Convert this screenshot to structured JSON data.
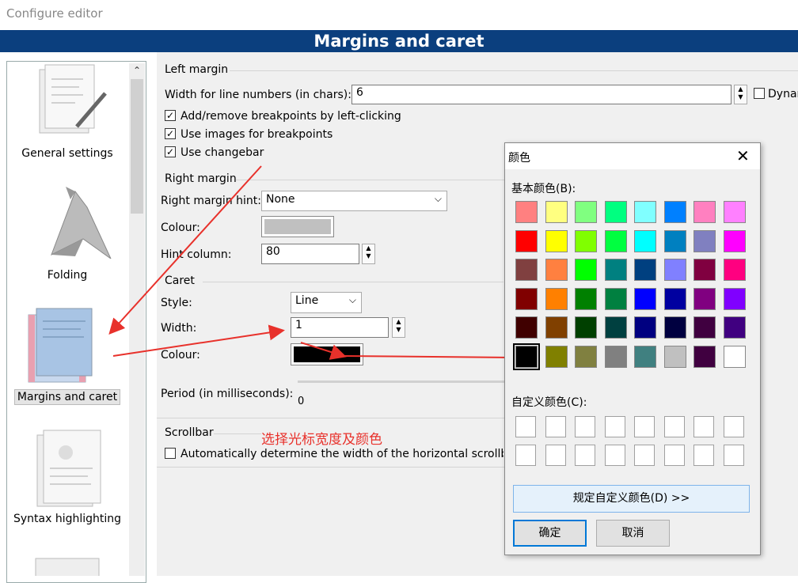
{
  "window": {
    "title": "Configure editor"
  },
  "banner": {
    "title": "Margins and caret"
  },
  "sidebar": {
    "items": [
      {
        "label": "General settings",
        "icon": "pencil-document-icon"
      },
      {
        "label": "Folding",
        "icon": "origami-bird-icon"
      },
      {
        "label": "Margins and caret",
        "icon": "margins-document-icon",
        "selected": true
      },
      {
        "label": "Syntax highlighting",
        "icon": "highlight-document-icon"
      }
    ]
  },
  "left_margin": {
    "title": "Left margin",
    "line_numbers_label": "Width for line numbers (in chars):",
    "line_numbers_value": "6",
    "dynamic_label": "Dynar",
    "dynamic_checked": false,
    "breakpoints_label": "Add/remove breakpoints by left-clicking",
    "breakpoints_checked": true,
    "images_label": "Use images for breakpoints",
    "images_checked": true,
    "changebar_label": "Use changebar",
    "changebar_checked": true
  },
  "right_margin": {
    "title": "Right margin",
    "hint_label": "Right margin hint:",
    "hint_value": "None",
    "colour_label": "Colour:",
    "colour_value": "#c0c0c0",
    "hint_column_label": "Hint column:",
    "hint_column_value": "80"
  },
  "caret": {
    "title": "Caret",
    "style_label": "Style:",
    "style_value": "Line",
    "width_label": "Width:",
    "width_value": "1",
    "colour_label": "Colour:",
    "colour_value": "#000000",
    "period_label": "Period (in milliseconds):",
    "period_value": "0"
  },
  "scrollbar": {
    "title": "Scrollbar",
    "auto_label": "Automatically determine the width of the horizontal scrollba",
    "auto_checked": false
  },
  "annotation": {
    "text": "选择光标宽度及颜色",
    "color": "#e8312b"
  },
  "color_dialog": {
    "title": "颜色",
    "basic_label": "基本颜色(B):",
    "custom_label": "自定义颜色(C):",
    "define_button": "规定自定义颜色(D) >>",
    "ok_button": "确定",
    "cancel_button": "取消",
    "selected_index": 40,
    "basic_colors": [
      "#ff8080",
      "#ffff80",
      "#80ff80",
      "#00ff80",
      "#80ffff",
      "#0080ff",
      "#ff80c0",
      "#ff80ff",
      "#ff0000",
      "#ffff00",
      "#80ff00",
      "#00ff40",
      "#00ffff",
      "#0080c0",
      "#8080c0",
      "#ff00ff",
      "#804040",
      "#ff8040",
      "#00ff00",
      "#008080",
      "#004080",
      "#8080ff",
      "#800040",
      "#ff0080",
      "#800000",
      "#ff8000",
      "#008000",
      "#008040",
      "#0000ff",
      "#0000a0",
      "#800080",
      "#8000ff",
      "#400000",
      "#804000",
      "#004000",
      "#004040",
      "#000080",
      "#000040",
      "#400040",
      "#400080",
      "#000000",
      "#808000",
      "#808040",
      "#808080",
      "#408080",
      "#c0c0c0",
      "#400040",
      "#ffffff"
    ],
    "custom_colors_count": 16
  }
}
